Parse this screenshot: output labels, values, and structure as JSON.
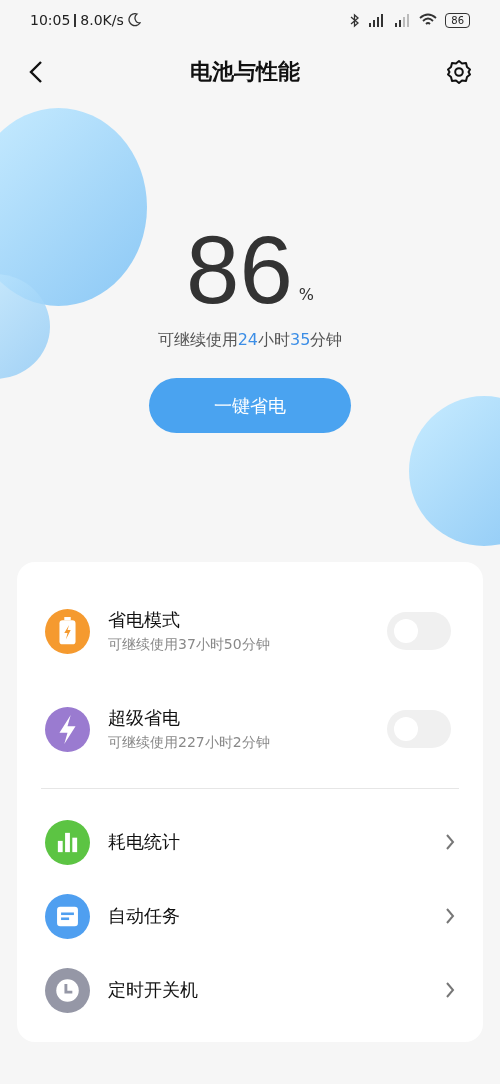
{
  "status_bar": {
    "time": "10:05",
    "speed": "8.0K/s",
    "battery": "86"
  },
  "header": {
    "title": "电池与性能"
  },
  "battery": {
    "percent": "86",
    "unit": "%",
    "remaining": [
      {
        "kind": "text",
        "text": "可继续使用"
      },
      {
        "kind": "number",
        "text": "24"
      },
      {
        "kind": "text",
        "text": "小时"
      },
      {
        "kind": "number",
        "text": "35"
      },
      {
        "kind": "text",
        "text": "分钟"
      }
    ],
    "button": "一键省电"
  },
  "modes": [
    {
      "kind": "battery",
      "color": "#f59a2f",
      "title": "省电模式",
      "subtitle": "可继续使用37小时50分钟",
      "on": false
    },
    {
      "kind": "bolt",
      "color": "#9a7bd0",
      "title": "超级省电",
      "subtitle": "可继续使用227小时2分钟",
      "on": false
    }
  ],
  "links": [
    {
      "kind": "chart",
      "color": "#5cc443",
      "title": "耗电统计"
    },
    {
      "kind": "note",
      "color": "#4f9ff0",
      "title": "自动任务"
    },
    {
      "kind": "clock",
      "color": "#9597a6",
      "title": "定时开关机"
    }
  ]
}
